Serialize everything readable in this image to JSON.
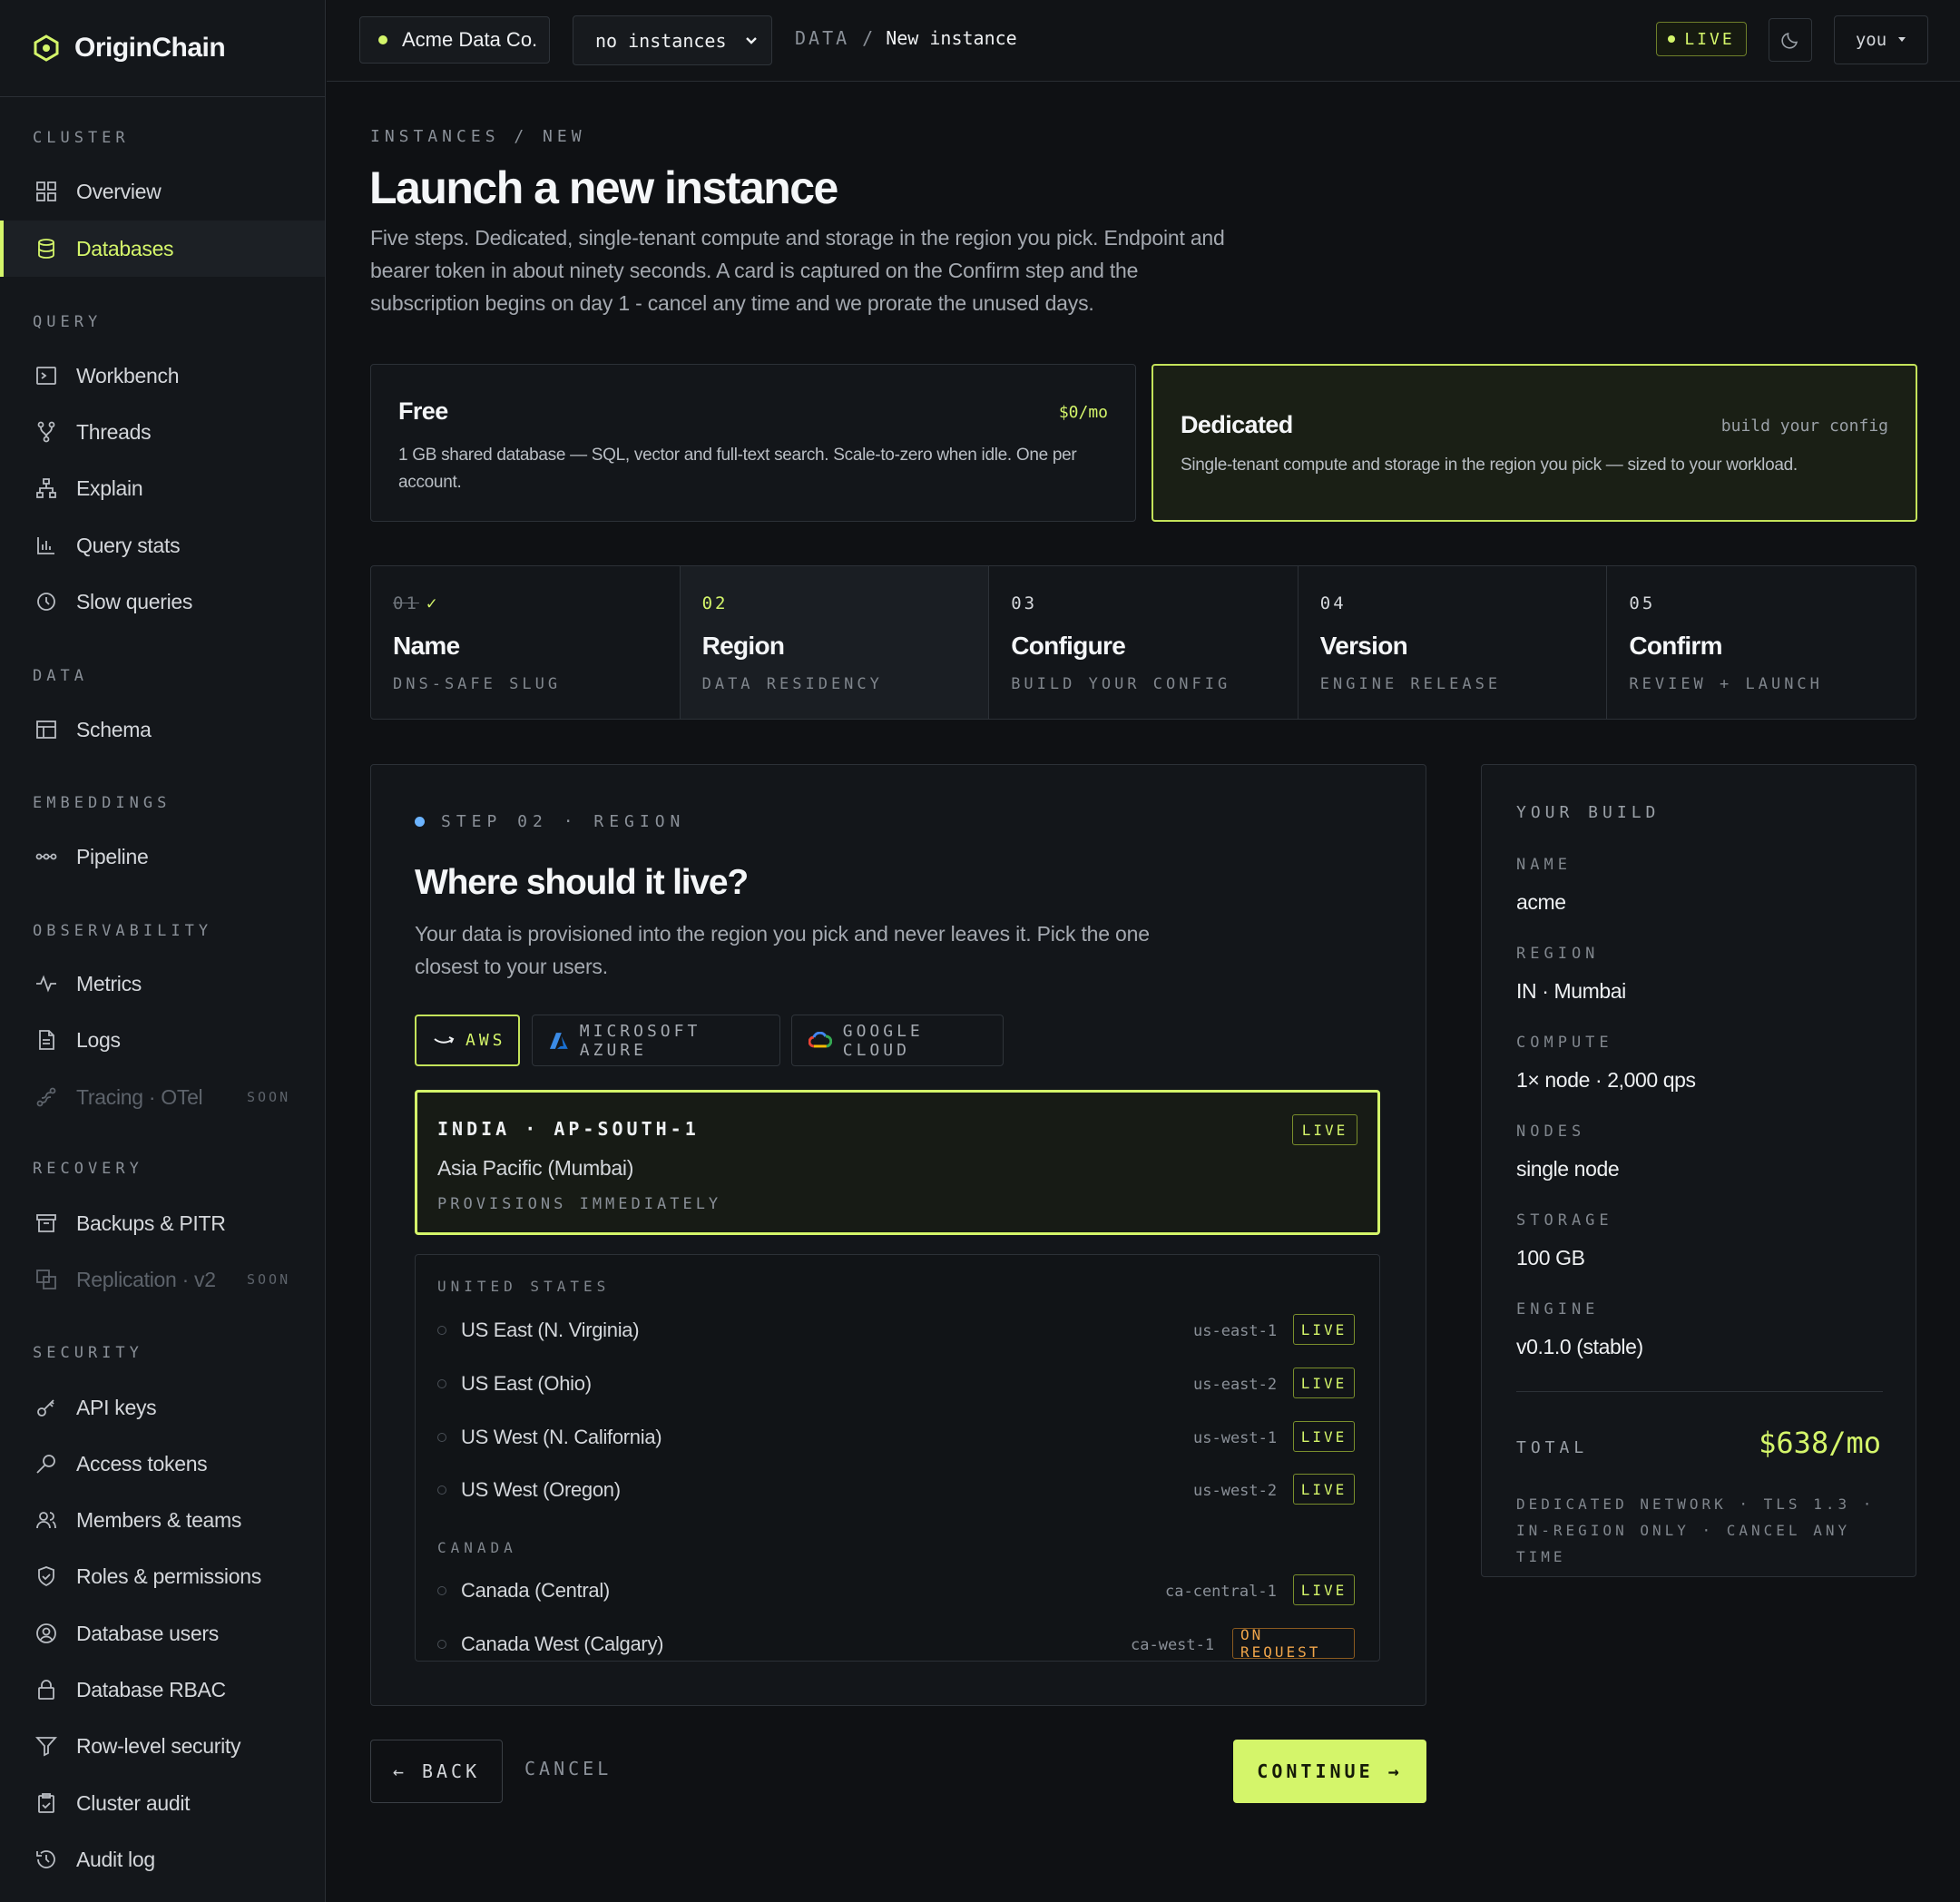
{
  "brand": {
    "name": "OriginChain"
  },
  "sidebar": {
    "sections": [
      {
        "label": "CLUSTER",
        "items": [
          {
            "label": "Overview",
            "icon": "grid-icon"
          },
          {
            "label": "Databases",
            "icon": "database-icon",
            "active": true
          }
        ]
      },
      {
        "label": "QUERY",
        "items": [
          {
            "label": "Workbench",
            "icon": "terminal-icon"
          },
          {
            "label": "Threads",
            "icon": "branch-icon"
          },
          {
            "label": "Explain",
            "icon": "tree-icon"
          },
          {
            "label": "Query stats",
            "icon": "bar-chart-icon"
          },
          {
            "label": "Slow queries",
            "icon": "clock-icon"
          }
        ]
      },
      {
        "label": "DATA",
        "items": [
          {
            "label": "Schema",
            "icon": "table-icon"
          }
        ]
      },
      {
        "label": "EMBEDDINGS",
        "items": [
          {
            "label": "Pipeline",
            "icon": "pipeline-icon"
          }
        ]
      },
      {
        "label": "OBSERVABILITY",
        "items": [
          {
            "label": "Metrics",
            "icon": "pulse-icon"
          },
          {
            "label": "Logs",
            "icon": "file-icon"
          },
          {
            "label": "Tracing · OTel",
            "icon": "trace-icon",
            "disabled": true,
            "badge": "SOON"
          }
        ]
      },
      {
        "label": "RECOVERY",
        "items": [
          {
            "label": "Backups & PITR",
            "icon": "archive-icon"
          },
          {
            "label": "Replication · v2",
            "icon": "copy-icon",
            "disabled": true,
            "badge": "SOON"
          }
        ]
      },
      {
        "label": "SECURITY",
        "items": [
          {
            "label": "API keys",
            "icon": "key-icon"
          },
          {
            "label": "Access tokens",
            "icon": "token-icon"
          },
          {
            "label": "Members & teams",
            "icon": "users-icon"
          },
          {
            "label": "Roles & permissions",
            "icon": "shield-icon"
          },
          {
            "label": "Database users",
            "icon": "user-circle-icon"
          },
          {
            "label": "Database RBAC",
            "icon": "lock-icon"
          },
          {
            "label": "Row-level security",
            "icon": "filter-icon"
          },
          {
            "label": "Cluster audit",
            "icon": "clipboard-icon"
          },
          {
            "label": "Audit log",
            "icon": "history-icon"
          }
        ]
      }
    ]
  },
  "topbar": {
    "org": "Acme Data Co.",
    "instance_select": "no instances",
    "breadcrumb": {
      "section": "DATA",
      "sep": "/",
      "page": "New instance"
    },
    "status": "LIVE",
    "user": "you"
  },
  "page": {
    "eyebrow": "INSTANCES / NEW",
    "title": "Launch a new instance",
    "lead": "Five steps. Dedicated, single-tenant compute and storage in the region you pick. Endpoint and bearer token in about ninety seconds. A card is captured on the Confirm step and the subscription begins on day 1 - cancel any time and we prorate the unused days."
  },
  "plans": {
    "free": {
      "name": "Free",
      "price": "$0/mo",
      "desc": "1 GB shared database — SQL, vector and full-text search. Scale-to-zero when idle. One per account."
    },
    "dedicated": {
      "name": "Dedicated",
      "price": "build your config",
      "desc": "Single-tenant compute and storage in the region you pick — sized to your workload."
    }
  },
  "steps": [
    {
      "num": "01",
      "check": "✓",
      "title": "Name",
      "sub": "DNS-SAFE SLUG",
      "state": "done"
    },
    {
      "num": "02",
      "title": "Region",
      "sub": "DATA RESIDENCY",
      "state": "current"
    },
    {
      "num": "03",
      "title": "Configure",
      "sub": "BUILD YOUR CONFIG",
      "state": "todo"
    },
    {
      "num": "04",
      "title": "Version",
      "sub": "ENGINE RELEASE",
      "state": "todo"
    },
    {
      "num": "05",
      "title": "Confirm",
      "sub": "REVIEW + LAUNCH",
      "state": "todo"
    }
  ],
  "region_step": {
    "tag": "STEP 02 · REGION",
    "title": "Where should it live?",
    "desc": "Your data is provisioned into the region you pick and never leaves it. Pick the one closest to your users.",
    "providers": [
      {
        "label": "AWS",
        "icon": "aws-icon",
        "active": true
      },
      {
        "label": "MICROSOFT AZURE",
        "icon": "azure-icon"
      },
      {
        "label": "GOOGLE CLOUD",
        "icon": "google-cloud-icon"
      }
    ],
    "selected": {
      "code": "INDIA · AP-SOUTH-1",
      "name": "Asia Pacific (Mumbai)",
      "note": "PROVISIONS IMMEDIATELY",
      "badge": "LIVE"
    },
    "groups": [
      {
        "label": "UNITED STATES",
        "regions": [
          {
            "name": "US East (N. Virginia)",
            "id": "us-east-1",
            "status": "LIVE"
          },
          {
            "name": "US East (Ohio)",
            "id": "us-east-2",
            "status": "LIVE"
          },
          {
            "name": "US West (N. California)",
            "id": "us-west-1",
            "status": "LIVE"
          },
          {
            "name": "US West (Oregon)",
            "id": "us-west-2",
            "status": "LIVE"
          }
        ]
      },
      {
        "label": "CANADA",
        "regions": [
          {
            "name": "Canada (Central)",
            "id": "ca-central-1",
            "status": "LIVE"
          },
          {
            "name": "Canada West (Calgary)",
            "id": "ca-west-1",
            "status": "ON REQUEST"
          }
        ]
      }
    ]
  },
  "actions": {
    "back": "← BACK",
    "cancel": "CANCEL",
    "continue": "CONTINUE →"
  },
  "build": {
    "title": "YOUR BUILD",
    "fields": [
      {
        "key": "NAME",
        "value": "acme"
      },
      {
        "key": "REGION",
        "value": "IN · Mumbai"
      },
      {
        "key": "COMPUTE",
        "value": "1× node · 2,000 qps"
      },
      {
        "key": "NODES",
        "value": "single node"
      },
      {
        "key": "STORAGE",
        "value": "100 GB"
      },
      {
        "key": "ENGINE",
        "value": "v0.1.0 (stable)"
      }
    ],
    "total_label": "TOTAL",
    "total_value": "$638/mo",
    "footnote": "DEDICATED NETWORK · TLS 1.3 · IN-REGION ONLY · CANCEL ANY TIME"
  },
  "colors": {
    "accent": "#d4f56a",
    "background": "#0f1114",
    "panel": "#13161a",
    "info_dot": "#6cb4ff",
    "on_request": "#f0a54a"
  }
}
